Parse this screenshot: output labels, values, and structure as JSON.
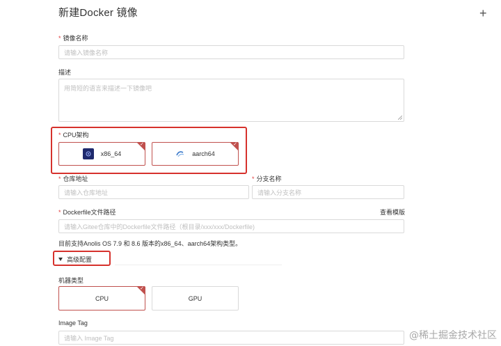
{
  "page": {
    "title": "新建Docker 镜像"
  },
  "header": {
    "add_icon": "plus-icon"
  },
  "form": {
    "image_name": {
      "label": "镜像名称",
      "placeholder": "请输入镜像名称",
      "required": true
    },
    "description": {
      "label": "描述",
      "placeholder": "用简短的语言来描述一下镜像吧",
      "required": false
    },
    "cpu_arch": {
      "label": "CPU架构",
      "required": true,
      "options": [
        {
          "label": "x86_64",
          "icon": "intel-logo-icon",
          "selected": true
        },
        {
          "label": "aarch64",
          "icon": "arm-logo-icon",
          "selected": true
        }
      ]
    },
    "repo_url": {
      "label": "仓库地址",
      "placeholder": "请输入仓库地址",
      "required": true
    },
    "branch_name": {
      "label": "分支名称",
      "placeholder": "请输入分支名称",
      "required": true
    },
    "dockerfile_path": {
      "label": "Dockerfile文件路径",
      "required": true,
      "view_template": "查看模版",
      "placeholder": "请输入Gitee仓库中的Dockerfile文件路径（根目录/xxx/xxx/Dockerfile)"
    },
    "support_note": "目前支持Anolis OS 7.9 和 8.6 版本的x86_64、aarch64架构类型。",
    "advanced": {
      "label": "高级配置",
      "icon": "caret-down-icon"
    },
    "machine_type": {
      "label": "机器类型",
      "options": [
        {
          "label": "CPU",
          "selected": true
        },
        {
          "label": "GPU",
          "selected": false
        }
      ]
    },
    "image_tag": {
      "label": "Image Tag",
      "placeholder": "请输入 Image Tag"
    }
  },
  "watermark": "@稀土掘金技术社区",
  "colors": {
    "selected_border": "#c0504d",
    "highlight_box": "#d6312c",
    "required_star": "#e03c3c"
  }
}
